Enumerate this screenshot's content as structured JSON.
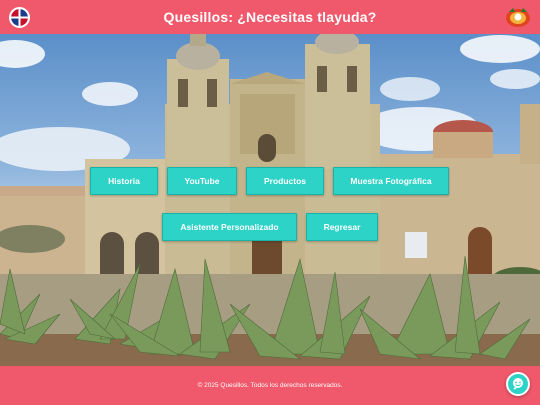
{
  "header": {
    "title": "Quesillos: ¿Necesitas tlayuda?",
    "left_logo_icon": "bilingual-flag-logo",
    "right_logo_icon": "quesillos-emblem"
  },
  "nav": {
    "historia": "Historia",
    "youtube": "YouTube",
    "productos": "Productos",
    "muestra": "Muestra Fotográfica",
    "asistente": "Asistente Personalizado",
    "regresar": "Regresar"
  },
  "hero": {
    "image_subject": "church-and-agave-photo"
  },
  "footer": {
    "copyright": "© 2025 Quesillos. Todos los derechos reservados."
  },
  "chat": {
    "icon": "chat-assistant-icon"
  },
  "colors": {
    "header_bg": "#f0586b",
    "button_bg": "#2ed3c8",
    "footer_bg": "#f0586b"
  }
}
